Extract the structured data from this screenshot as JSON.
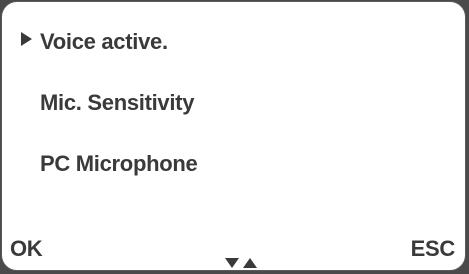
{
  "menu": {
    "items": [
      {
        "label": "Voice active.",
        "selected": true
      },
      {
        "label": "Mic. Sensitivity",
        "selected": false
      },
      {
        "label": "PC Microphone",
        "selected": false
      }
    ]
  },
  "softkeys": {
    "left": "OK",
    "right": "ESC"
  },
  "navigation": {
    "icons": [
      "arrow-down-icon",
      "arrow-up-icon"
    ]
  },
  "colors": {
    "screen_background": "#ffffff",
    "text": "#3a3a3a",
    "bezel": "#4a4a4a"
  }
}
